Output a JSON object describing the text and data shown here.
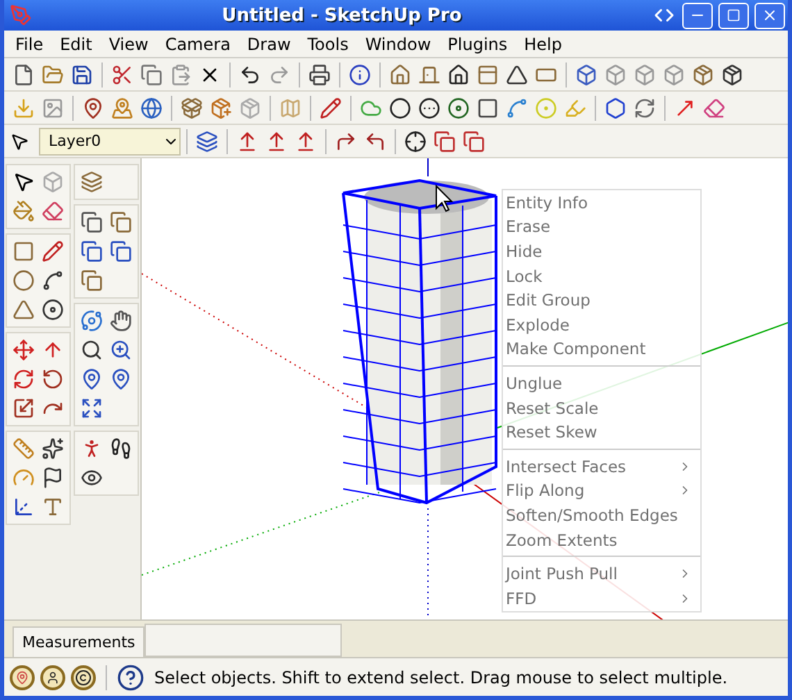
{
  "window": {
    "title": "Untitled - SketchUp Pro"
  },
  "menu": [
    "File",
    "Edit",
    "View",
    "Camera",
    "Draw",
    "Tools",
    "Window",
    "Plugins",
    "Help"
  ],
  "layer": {
    "value": "Layer0"
  },
  "context_menu": [
    {
      "kind": "item",
      "label": "Entity Info",
      "submenu": false
    },
    {
      "kind": "item",
      "label": "Erase",
      "submenu": false
    },
    {
      "kind": "item",
      "label": "Hide",
      "submenu": false
    },
    {
      "kind": "item",
      "label": "Lock",
      "submenu": false
    },
    {
      "kind": "item",
      "label": "Edit Group",
      "submenu": false
    },
    {
      "kind": "item",
      "label": "Explode",
      "submenu": false
    },
    {
      "kind": "item",
      "label": "Make Component",
      "submenu": false
    },
    {
      "kind": "separator"
    },
    {
      "kind": "item",
      "label": "Unglue",
      "submenu": false
    },
    {
      "kind": "item",
      "label": "Reset Scale",
      "submenu": false
    },
    {
      "kind": "item",
      "label": "Reset Skew",
      "submenu": false
    },
    {
      "kind": "separator"
    },
    {
      "kind": "item",
      "label": "Intersect Faces",
      "submenu": true
    },
    {
      "kind": "item",
      "label": "Flip Along",
      "submenu": true
    },
    {
      "kind": "item",
      "label": "Soften/Smooth Edges",
      "submenu": false
    },
    {
      "kind": "item",
      "label": "Zoom Extents",
      "submenu": false
    },
    {
      "kind": "separator"
    },
    {
      "kind": "item",
      "label": "Joint Push Pull",
      "submenu": true
    },
    {
      "kind": "item",
      "label": "FFD",
      "submenu": true
    }
  ],
  "measurements": {
    "label": "Measurements"
  },
  "status_bar": {
    "text": "Select objects. Shift to extend select. Drag mouse to select multiple."
  }
}
